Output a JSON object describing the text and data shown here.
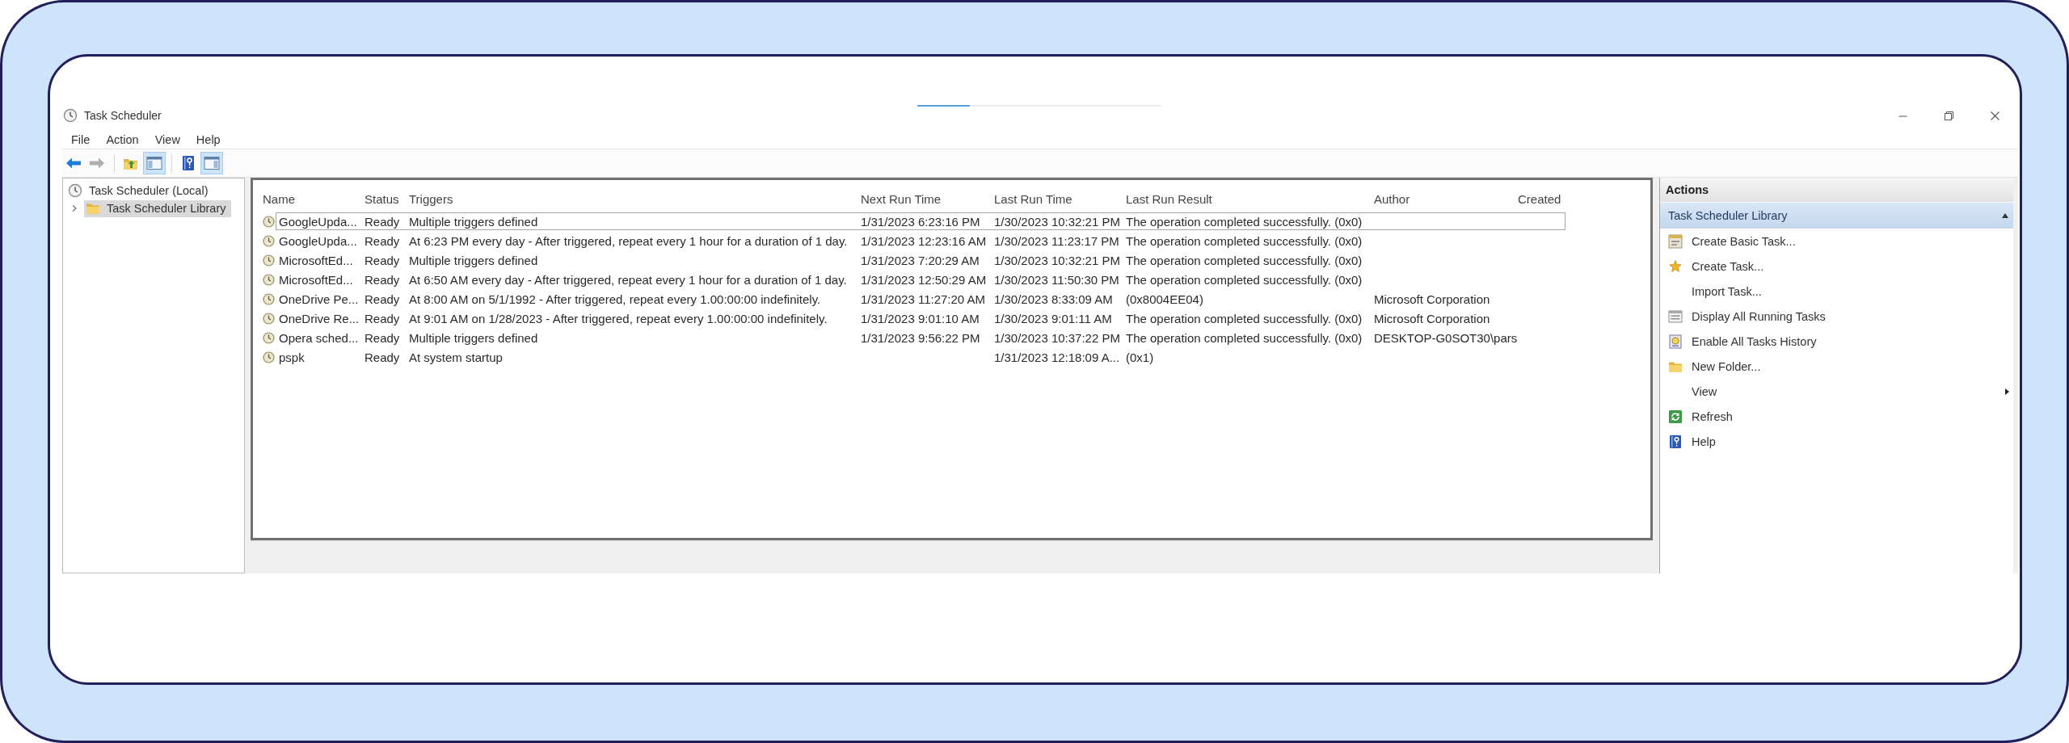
{
  "window": {
    "title": "Task Scheduler"
  },
  "menu": [
    "File",
    "Action",
    "View",
    "Help"
  ],
  "toolbar": [
    {
      "disabled": false,
      "pressed": false
    },
    {
      "disabled": true,
      "pressed": false
    },
    {
      "disabled": false,
      "pressed": false
    },
    {
      "disabled": false,
      "pressed": true
    },
    {
      "disabled": false,
      "pressed": false
    },
    {
      "disabled": false,
      "pressed": true
    }
  ],
  "tree": [
    {
      "label": "Task Scheduler (Local)",
      "selected": false,
      "children": [
        {
          "label": "Task Scheduler Library",
          "selected": true,
          "expanded": false
        }
      ]
    }
  ],
  "table": {
    "columns": [
      "Name",
      "Status",
      "Triggers",
      "Next Run Time",
      "Last Run Time",
      "Last Run Result",
      "Author",
      "Created"
    ],
    "rows": [
      {
        "name": "GoogleUpda...",
        "status": "Ready",
        "triggers": "Multiple triggers defined",
        "next_run_time": "1/31/2023 6:23:16 PM",
        "last_run_time": "1/30/2023 10:32:21 PM",
        "last_run_result": "The operation completed successfully. (0x0)",
        "focused": true
      },
      {
        "name": "GoogleUpda...",
        "status": "Ready",
        "triggers": "At 6:23 PM every day - After triggered, repeat every 1 hour for a duration of 1 day.",
        "next_run_time": "1/31/2023 12:23:16 AM",
        "last_run_time": "1/30/2023 11:23:17 PM",
        "last_run_result": "The operation completed successfully. (0x0)",
        "focused": false
      },
      {
        "name": "MicrosoftEd...",
        "status": "Ready",
        "triggers": "Multiple triggers defined",
        "next_run_time": "1/31/2023 7:20:29 AM",
        "last_run_time": "1/30/2023 10:32:21 PM",
        "last_run_result": "The operation completed successfully. (0x0)",
        "focused": false
      },
      {
        "name": "MicrosoftEd...",
        "status": "Ready",
        "triggers": "At 6:50 AM every day - After triggered, repeat every 1 hour for a duration of 1 day.",
        "next_run_time": "1/31/2023 12:50:29 AM",
        "last_run_time": "1/30/2023 11:50:30 PM",
        "last_run_result": "The operation completed successfully. (0x0)",
        "focused": false
      },
      {
        "name": "OneDrive Pe...",
        "status": "Ready",
        "triggers": "At 8:00 AM on 5/1/1992 - After triggered, repeat every 1.00:00:00 indefinitely.",
        "next_run_time": "1/31/2023 11:27:20 AM",
        "last_run_time": "1/30/2023 8:33:09 AM",
        "last_run_result": "(0x8004EE04)",
        "author": "Microsoft Corporation",
        "focused": false
      },
      {
        "name": "OneDrive Re...",
        "status": "Ready",
        "triggers": "At 9:01 AM on 1/28/2023 - After triggered, repeat every 1.00:00:00 indefinitely.",
        "next_run_time": "1/31/2023 9:01:10 AM",
        "last_run_time": "1/30/2023 9:01:11 AM",
        "last_run_result": "The operation completed successfully. (0x0)",
        "author": "Microsoft Corporation",
        "focused": false
      },
      {
        "name": "Opera sched...",
        "status": "Ready",
        "triggers": "Multiple triggers defined",
        "next_run_time": "1/31/2023 9:56:22 PM",
        "last_run_time": "1/30/2023 10:37:22 PM",
        "last_run_result": "The operation completed successfully. (0x0)",
        "author": "DESKTOP-G0SOT30\\pars",
        "focused": false
      },
      {
        "name": "pspk",
        "status": "Ready",
        "triggers": "At system startup",
        "last_run_time": "1/31/2023 12:18:09 A...",
        "last_run_result": "(0x1)",
        "focused": false
      }
    ]
  },
  "actions": {
    "title": "Actions",
    "sections": [
      {
        "title": "Task Scheduler Library",
        "expanded": true,
        "items": [
          {
            "label": "Create Basic Task...",
            "submenu": false
          },
          {
            "label": "Create Task...",
            "submenu": false
          },
          {
            "label": "Import Task...",
            "submenu": false
          },
          {
            "label": "Display All Running Tasks",
            "submenu": false
          },
          {
            "label": "Enable All Tasks History",
            "submenu": false
          },
          {
            "label": "New Folder...",
            "submenu": false
          },
          {
            "label": "View",
            "submenu": true
          },
          {
            "label": "Refresh",
            "submenu": false
          },
          {
            "label": "Help",
            "submenu": false
          }
        ]
      }
    ]
  }
}
